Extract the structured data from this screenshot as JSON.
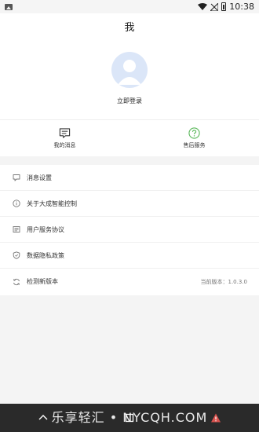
{
  "status_bar": {
    "time": "10:38",
    "icons": [
      "image-icon",
      "wifi-icon",
      "signal-icon",
      "battery-icon"
    ]
  },
  "header": {
    "title": "我"
  },
  "profile": {
    "login_label": "立即登录",
    "avatar_icon": "default-avatar-icon"
  },
  "quick_actions": [
    {
      "label": "我的消息",
      "icon": "message-icon",
      "color": "#333333"
    },
    {
      "label": "售后服务",
      "icon": "help-icon",
      "color": "#5cb85c"
    }
  ],
  "menu": [
    {
      "label": "消息设置",
      "icon": "chat-bubble-icon",
      "value": ""
    },
    {
      "label": "关于大成智能控制",
      "icon": "info-icon",
      "value": ""
    },
    {
      "label": "用户服务协议",
      "icon": "document-icon",
      "value": ""
    },
    {
      "label": "数据隐私政策",
      "icon": "shield-icon",
      "value": ""
    },
    {
      "label": "检测新版本",
      "icon": "refresh-icon",
      "value": "当前版本：1.0.3.0"
    }
  ],
  "watermark": "乐享轻汇 • NYCQH.COM",
  "colors": {
    "accent_green": "#5cb85c",
    "background": "#f4f4f4",
    "avatar_bg": "#dbe6f8",
    "nav_bar": "#2a2a2a"
  }
}
